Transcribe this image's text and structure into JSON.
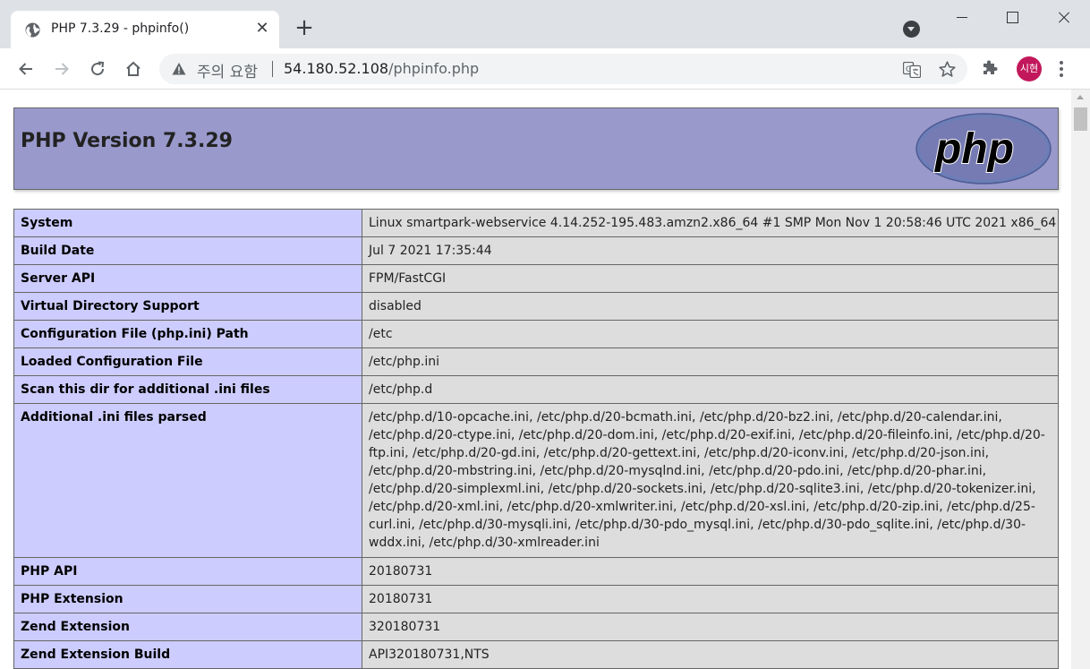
{
  "tab": {
    "title": "PHP 7.3.29 - phpinfo()",
    "favicon": "globe-icon",
    "close_glyph": "✕"
  },
  "new_tab_glyph": "+",
  "toolbar": {
    "security_label": "주의 요함",
    "url_host": "54.180.52.108",
    "url_path": "/phpinfo.php",
    "avatar_text": "시현",
    "avatar_color": "#c2185b"
  },
  "page": {
    "title": "PHP Version 7.3.29",
    "logo_text": "php",
    "header_color": "#9999cc",
    "key_cell_color": "#ccccff",
    "value_cell_color": "#dddddd"
  },
  "rows": [
    {
      "key": "System",
      "value": "Linux smartpark-webservice 4.14.252-195.483.amzn2.x86_64 #1 SMP Mon Nov 1 20:58:46 UTC 2021 x86_64"
    },
    {
      "key": "Build Date",
      "value": "Jul 7 2021 17:35:44"
    },
    {
      "key": "Server API",
      "value": "FPM/FastCGI"
    },
    {
      "key": "Virtual Directory Support",
      "value": "disabled"
    },
    {
      "key": "Configuration File (php.ini) Path",
      "value": "/etc"
    },
    {
      "key": "Loaded Configuration File",
      "value": "/etc/php.ini"
    },
    {
      "key": "Scan this dir for additional .ini files",
      "value": "/etc/php.d"
    },
    {
      "key": "Additional .ini files parsed",
      "value_lines": [
        "/etc/php.d/10-opcache.ini, /etc/php.d/20-bcmath.ini, /etc/php.d/20-bz2.ini, /etc/php.d/20-calendar.ini,",
        "/etc/php.d/20-ctype.ini, /etc/php.d/20-dom.ini, /etc/php.d/20-exif.ini, /etc/php.d/20-fileinfo.ini, /etc/php.d/20-",
        "ftp.ini, /etc/php.d/20-gd.ini, /etc/php.d/20-gettext.ini, /etc/php.d/20-iconv.ini, /etc/php.d/20-json.ini,",
        "/etc/php.d/20-mbstring.ini, /etc/php.d/20-mysqlnd.ini, /etc/php.d/20-pdo.ini, /etc/php.d/20-phar.ini,",
        "/etc/php.d/20-simplexml.ini, /etc/php.d/20-sockets.ini, /etc/php.d/20-sqlite3.ini, /etc/php.d/20-tokenizer.ini,",
        "/etc/php.d/20-xml.ini, /etc/php.d/20-xmlwriter.ini, /etc/php.d/20-xsl.ini, /etc/php.d/20-zip.ini, /etc/php.d/25-",
        "curl.ini, /etc/php.d/30-mysqli.ini, /etc/php.d/30-pdo_mysql.ini, /etc/php.d/30-pdo_sqlite.ini, /etc/php.d/30-",
        "wddx.ini, /etc/php.d/30-xmlreader.ini"
      ]
    },
    {
      "key": "PHP API",
      "value": "20180731"
    },
    {
      "key": "PHP Extension",
      "value": "20180731"
    },
    {
      "key": "Zend Extension",
      "value": "320180731"
    },
    {
      "key": "Zend Extension Build",
      "value": "API320180731,NTS"
    }
  ]
}
